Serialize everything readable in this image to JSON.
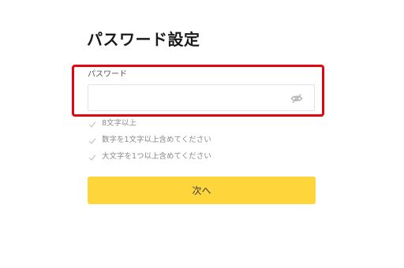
{
  "page": {
    "title": "パスワード設定"
  },
  "password_field": {
    "label": "パスワード",
    "value": "",
    "placeholder": "",
    "toggle_icon": "eye-slash-icon"
  },
  "rules": [
    {
      "icon": "check-icon",
      "text": "8文字以上"
    },
    {
      "icon": "check-icon",
      "text": "数字を1文字以上含めてください"
    },
    {
      "icon": "check-icon",
      "text": "大文字を1つ以上含めてください"
    }
  ],
  "next_button": {
    "label": "次へ"
  },
  "colors": {
    "highlight_border": "#e0070e",
    "button_background": "#fed53a",
    "rule_text": "#8a8a8a"
  }
}
